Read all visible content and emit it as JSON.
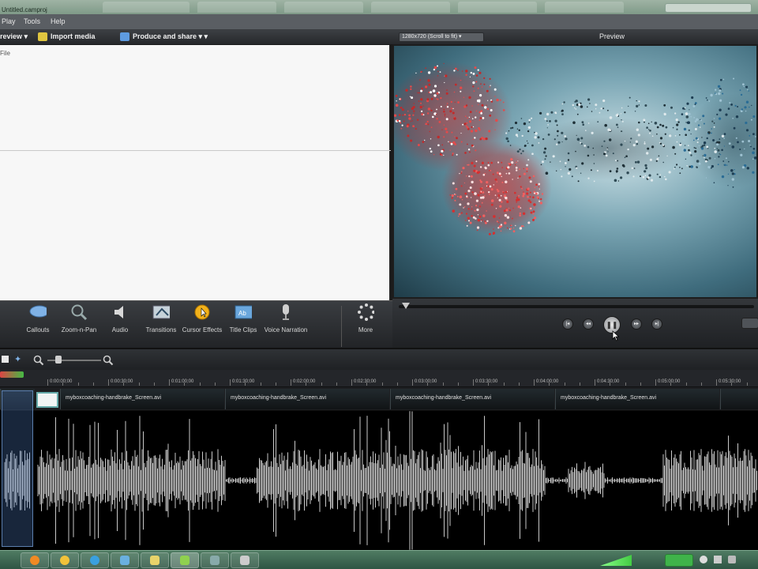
{
  "window": {
    "title": "Untitled.camproj",
    "restore_label": "",
    "menu": [
      "Play",
      "Tools",
      "Help"
    ]
  },
  "toolbar": {
    "view_label": "review",
    "import_label": "Import media",
    "produce_label": "Produce and share"
  },
  "clip_bin": {
    "header": "File"
  },
  "preview": {
    "dimensions_dropdown": "1280x720 (Scroll to fit)",
    "title": "Preview"
  },
  "tasks": [
    {
      "label": "Callouts",
      "icon": "callout-icon"
    },
    {
      "label": "Zoom-n-Pan",
      "icon": "zoom-n-pan-icon"
    },
    {
      "label": "Audio",
      "icon": "audio-icon"
    },
    {
      "label": "Transitions",
      "icon": "transitions-icon"
    },
    {
      "label": "Cursor Effects",
      "icon": "cursor-effects-icon"
    },
    {
      "label": "Title Clips",
      "icon": "title-clips-icon"
    },
    {
      "label": "Voice Narration",
      "icon": "microphone-icon"
    },
    {
      "label": "More",
      "icon": "more-icon"
    }
  ],
  "timeline": {
    "ruler_labels": [
      "0:00:00;00",
      "0:00:30;00",
      "0:01:00;00",
      "0:01:30;00",
      "0:02:00;00",
      "0:02:30;00",
      "0:03:00;00",
      "0:03:30;00",
      "0:04:00;00",
      "0:04:30;00",
      "0:05:00;00",
      "0:05:30;00",
      "0:06:00;00"
    ],
    "clips": [
      "myboxcoaching-handbrake_Screen.avi",
      "myboxcoaching-handbrake_Screen.avi",
      "myboxcoaching-handbrake_Screen.avi",
      "myboxcoaching-handbrake_Screen.avi"
    ]
  },
  "colors": {
    "accent_blue": "#5c7fae",
    "panel_dark": "#2a2c2f",
    "taskbar_green": "#3e6a52"
  }
}
